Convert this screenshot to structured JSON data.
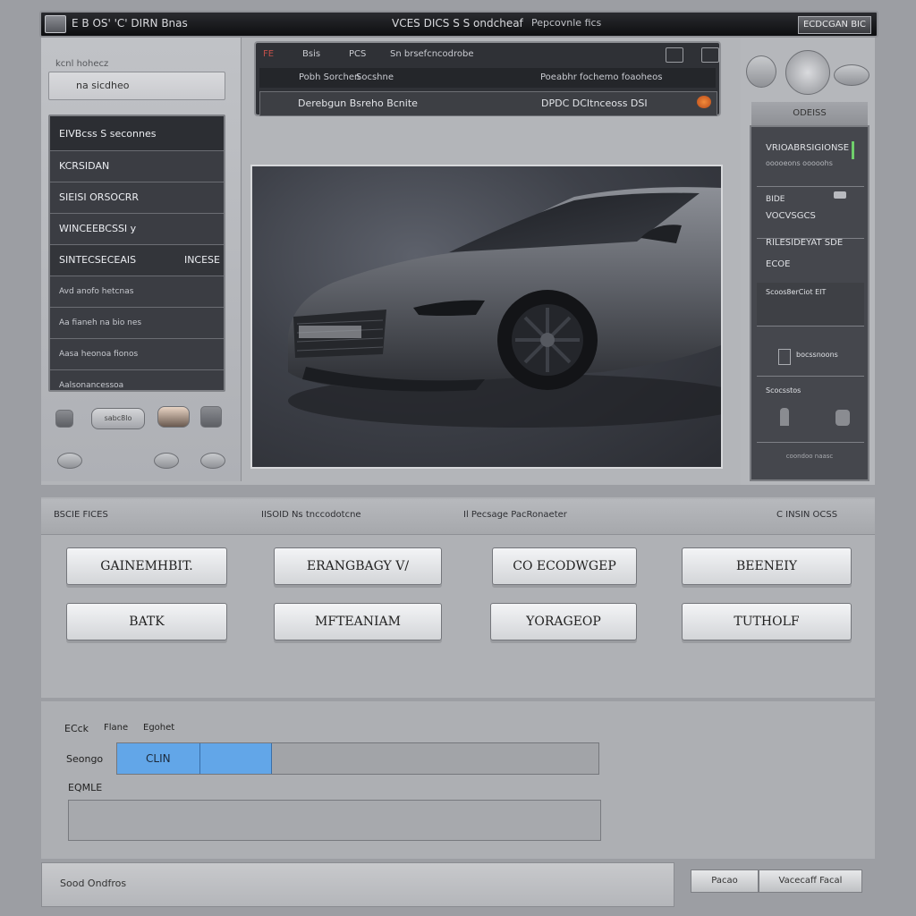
{
  "titlebar": {
    "left_title": "E B OS' 'C' DIRN Bnas",
    "center_title": "VCES DICS S S ondcheaf",
    "center_suffix": "Pepcovnle fics",
    "controls_label": "ECDCGAN BIC"
  },
  "left_panel": {
    "caption": "kcnl hohecz",
    "field_value": "na sicdheo",
    "list_header": "EIVBcss S seconnes",
    "items": [
      {
        "label": "KCRSIDAN",
        "right": ""
      },
      {
        "label": "SIEISI ORSOCRR",
        "right": ""
      },
      {
        "label": "WINCEEBCSSI y",
        "right": ""
      },
      {
        "label": "SINTECSECEAIS",
        "right": "INCESE"
      },
      {
        "label": "Avd anofo hetcnas",
        "right": ""
      },
      {
        "label": "Aa fianeh na bio nes",
        "right": ""
      },
      {
        "label": "Aasa heonoa fionos",
        "right": ""
      },
      {
        "label": "Aalsonancessoa",
        "right": ""
      }
    ],
    "control_label": "sabc8lo"
  },
  "center_top": {
    "row1": {
      "a": "FE",
      "b": "Bsis",
      "c": "PCS",
      "d": "Sn brsefcncodrobe"
    },
    "row2": {
      "a": "Pobh Sorchen",
      "b": "Socshne",
      "c": "Poeabhr fochemo foaoheos"
    },
    "row3": {
      "a": "Derebgun Bsreho Bcnite",
      "b": "DPDC DCItnceoss DSI"
    }
  },
  "right_panel": {
    "caption": "ODEISS",
    "sec1": {
      "a": "VRIOABRSIGIONSE",
      "b": "ooooeons ooooohs"
    },
    "sec2": {
      "a": "BIDE",
      "b": "VOCVSGCS"
    },
    "sec3": {
      "a": "RILESIDEYAT SDE",
      "b": "ECOE"
    },
    "sec4": {
      "a": "Scoos8erCiot EIT"
    },
    "sec5": {
      "a": "bocssnoons"
    },
    "sec6": {
      "a": "Scocsstos"
    },
    "footer": "coondoo naasc"
  },
  "function_section": {
    "headers": [
      "BSCIE FICES",
      "IISOID Ns tnccodotcne",
      "Il Pecsage PacRonaeter",
      "C INSIN OCSS"
    ],
    "buttons": [
      "GAINEMHBIT.",
      "ERANGBAGY V/",
      "CO ECODWGEP",
      "BEENEIY",
      "BATK",
      "MFTEANIAM",
      "YORAGEOP",
      "TUTHOLF"
    ]
  },
  "bottom_section": {
    "label_row": [
      "ECck",
      "Flane",
      "Egohet"
    ],
    "progress_label": "Seongo",
    "progress_text": "CLIN",
    "progress_fraction": 0.32,
    "notes_label": "EQMLE",
    "notes_value": ""
  },
  "statusbar": {
    "text": "Sood Ondfros",
    "button1": "Pacao",
    "button2": "Vacecaff Facal"
  }
}
